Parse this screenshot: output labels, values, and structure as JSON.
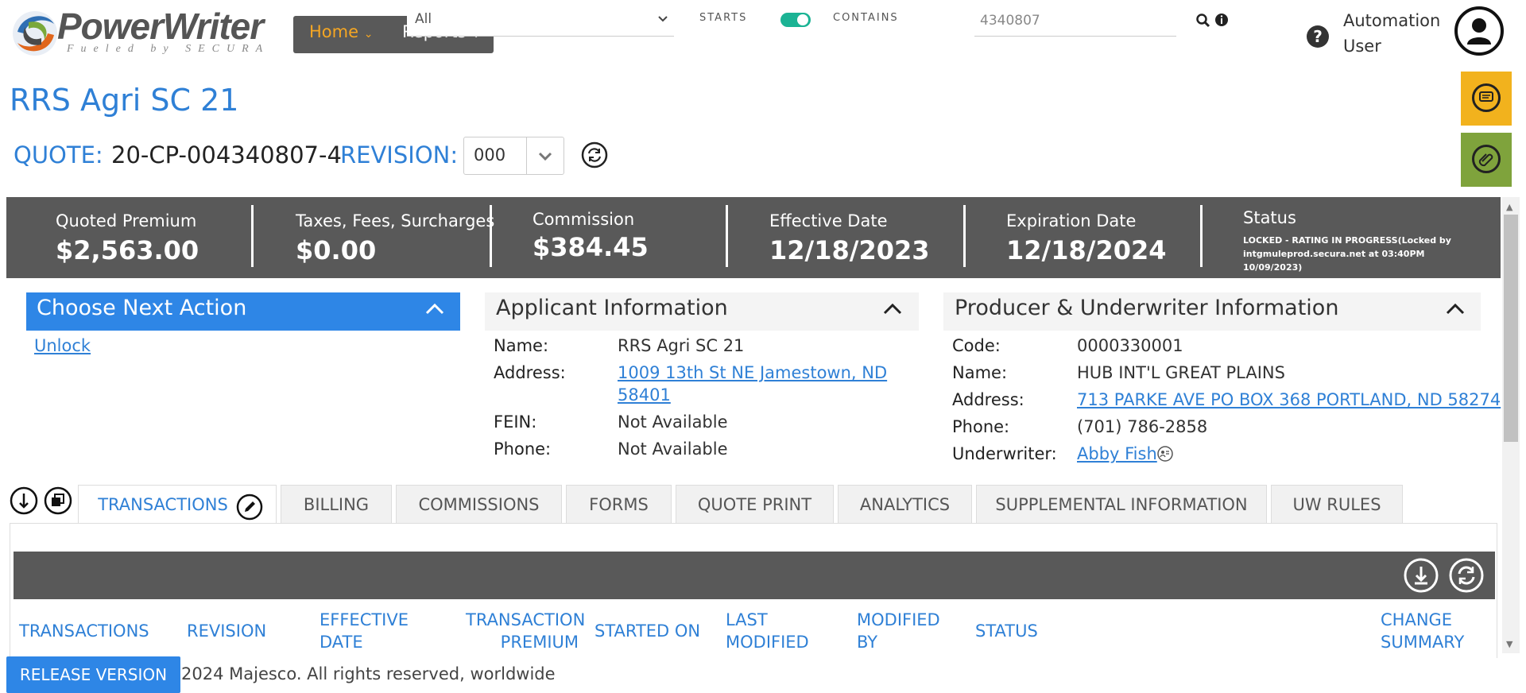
{
  "header": {
    "logo_text": "PowerWriter",
    "logo_tagline": "Fueled by SECURA",
    "menu": {
      "home_label": "Home",
      "reports_label": "Reports"
    },
    "scope_select": {
      "value": "All"
    },
    "search_mode": {
      "starts_label": "STARTS",
      "contains_label": "CONTAINS",
      "toggle_on": true
    },
    "search": {
      "value": "4340807"
    },
    "user": {
      "name_line1": "Automation",
      "name_line2": "User"
    },
    "icons": [
      "search-icon",
      "info-icon",
      "help-icon",
      "user-avatar-icon",
      "chat-icon",
      "attachment-icon"
    ]
  },
  "title": {
    "name": "RRS Agri SC 21",
    "quote_label": "QUOTE:",
    "quote_number": "20-CP-004340807-4",
    "revision_label": "REVISION:",
    "revision_value": "000"
  },
  "summary": [
    {
      "label": "Quoted Premium",
      "value": "$2,563.00"
    },
    {
      "label": "Taxes, Fees, Surcharges",
      "value": "$0.00"
    },
    {
      "label": "Commission",
      "value": "$384.45"
    },
    {
      "label": "Effective Date",
      "value": "12/18/2023"
    },
    {
      "label": "Expiration Date",
      "value": "12/18/2024"
    }
  ],
  "status": {
    "label": "Status",
    "line1": "LOCKED - RATING IN PROGRESS(Locked by",
    "line2": "intgmuleprod.secura.net at 03:40PM 10/09/2023)"
  },
  "next_action": {
    "title": "Choose Next Action",
    "unlock_label": "Unlock"
  },
  "applicant": {
    "title": "Applicant Information",
    "rows": [
      {
        "label": "Name:",
        "value": "RRS Agri SC 21"
      },
      {
        "label": "Address:",
        "value_line1": "1009 13th St NE Jamestown, ND",
        "value_line2": "58401"
      },
      {
        "label": "FEIN:",
        "value": "Not Available"
      },
      {
        "label": "Phone:",
        "value": "Not Available"
      }
    ]
  },
  "producer": {
    "title": "Producer & Underwriter Information",
    "rows": [
      {
        "label": "Code:",
        "value": "0000330001"
      },
      {
        "label": "Name:",
        "value": "HUB INT'L GREAT PLAINS"
      },
      {
        "label": "Address:",
        "value": "713 PARKE AVE PO BOX 368 PORTLAND, ND 58274"
      },
      {
        "label": "Phone:",
        "value": "(701) 786-2858"
      },
      {
        "label": "Underwriter:",
        "value": "Abby Fish"
      }
    ]
  },
  "tabs": [
    {
      "label": "TRANSACTIONS",
      "active": true
    },
    {
      "label": "BILLING"
    },
    {
      "label": "COMMISSIONS"
    },
    {
      "label": "FORMS"
    },
    {
      "label": "QUOTE PRINT"
    },
    {
      "label": "ANALYTICS"
    },
    {
      "label": "SUPPLEMENTAL INFORMATION"
    },
    {
      "label": "UW RULES"
    }
  ],
  "transactions_table": {
    "columns": [
      {
        "line1": "TRANSACTIONS",
        "line2": ""
      },
      {
        "line1": "REVISION",
        "line2": ""
      },
      {
        "line1": "EFFECTIVE",
        "line2": "DATE"
      },
      {
        "line1": "TRANSACTION",
        "line2": "PREMIUM"
      },
      {
        "line1": "STARTED ON",
        "line2": ""
      },
      {
        "line1": "LAST",
        "line2": "MODIFIED"
      },
      {
        "line1": "MODIFIED",
        "line2": "BY"
      },
      {
        "line1": "STATUS",
        "line2": ""
      },
      {
        "line1": "CHANGE",
        "line2": "SUMMARY"
      }
    ]
  },
  "footer": {
    "release_button": "RELEASE VERSION",
    "copyright": "2024 Majesco. All rights reserved, worldwide"
  },
  "colors": {
    "brand_blue": "#2f80d6",
    "accent_orange": "#f5a623",
    "dark_bar": "#595959",
    "toggle_green": "#1bb394",
    "chat_yellow": "#f2b21d",
    "attach_green": "#7fa33c"
  }
}
